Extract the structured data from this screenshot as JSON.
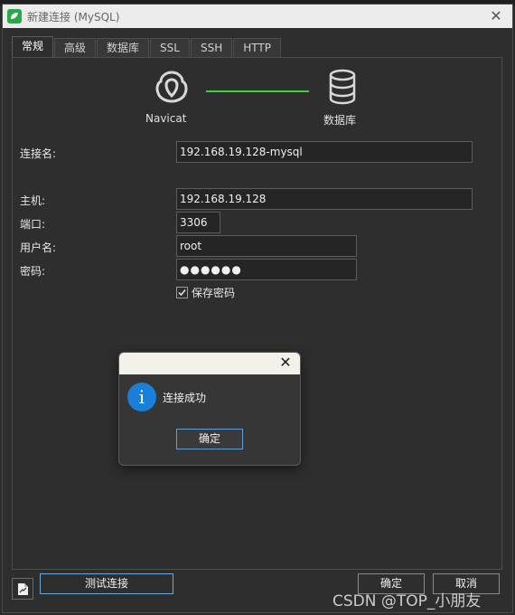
{
  "window": {
    "title": "新建连接 (MySQL)",
    "close_glyph": "✕"
  },
  "tabs": [
    {
      "label": "常规",
      "active": true
    },
    {
      "label": "高级",
      "active": false
    },
    {
      "label": "数据库",
      "active": false
    },
    {
      "label": "SSL",
      "active": false
    },
    {
      "label": "SSH",
      "active": false
    },
    {
      "label": "HTTP",
      "active": false
    }
  ],
  "hero": {
    "left_label": "Navicat",
    "right_label": "数据库",
    "link_color": "#3ad23a"
  },
  "form": {
    "connection_name_label": "连接名:",
    "connection_name_value": "192.168.19.128-mysql",
    "host_label": "主机:",
    "host_value": "192.168.19.128",
    "port_label": "端口:",
    "port_value": "3306",
    "user_label": "用户名:",
    "user_value": "root",
    "password_label": "密码:",
    "password_value": "●●●●●●",
    "save_password_label": "保存密码",
    "save_password_checked": true
  },
  "buttons": {
    "test_connection": "测试连接",
    "ok": "确定",
    "cancel": "取消"
  },
  "dialog": {
    "message": "连接成功",
    "ok_label": "确定",
    "close_glyph": "✕",
    "info_glyph": "i",
    "info_color": "#1a7fd8"
  },
  "watermark": "CSDN @TOP_小朋友"
}
